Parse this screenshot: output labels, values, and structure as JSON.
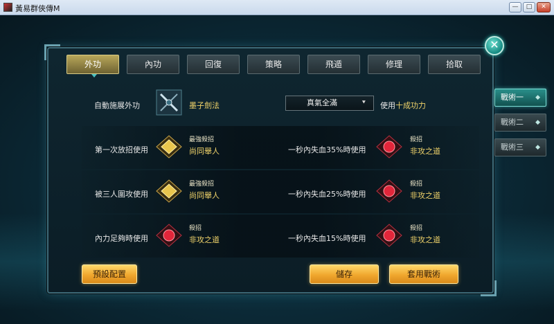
{
  "window": {
    "title": "黃易群俠傳M",
    "minimize": "—",
    "maximize": "□",
    "close": "✕"
  },
  "dialog": {
    "close_symbol": "✕"
  },
  "tabs": [
    {
      "label": "外功",
      "active": true
    },
    {
      "label": "內功",
      "active": false
    },
    {
      "label": "回復",
      "active": false
    },
    {
      "label": "策略",
      "active": false
    },
    {
      "label": "飛遁",
      "active": false
    },
    {
      "label": "修理",
      "active": false
    },
    {
      "label": "拾取",
      "active": false
    }
  ],
  "auto": {
    "label": "自動施展外功",
    "skill": "墨子劍法",
    "dropdown_value": "真氣全滿",
    "use_prefix": "使用",
    "use_highlight": "十成功力"
  },
  "slots": {
    "left_1": {
      "condition": "第一次放招使用",
      "type": "最強殺招",
      "name": "尚同舉人",
      "gem": "gold"
    },
    "left_2": {
      "condition": "被三人圍攻使用",
      "type": "最強殺招",
      "name": "尚同舉人",
      "gem": "gold"
    },
    "left_3": {
      "condition": "內力足夠時使用",
      "type": "殺招",
      "name": "非攻之道",
      "gem": "red"
    },
    "right_1": {
      "condition": "一秒內失血35%時使用",
      "type": "殺招",
      "name": "非攻之道",
      "gem": "red"
    },
    "right_2": {
      "condition": "一秒內失血25%時使用",
      "type": "殺招",
      "name": "非攻之道",
      "gem": "red"
    },
    "right_3": {
      "condition": "一秒內失血15%時使用",
      "type": "殺招",
      "name": "非攻之道",
      "gem": "red"
    }
  },
  "side_tabs": [
    {
      "label": "戰術一",
      "active": true
    },
    {
      "label": "戰術二",
      "active": false
    },
    {
      "label": "戰術三",
      "active": false
    }
  ],
  "side_marker": "◆",
  "buttons": {
    "preset": "預設配置",
    "save": "儲存",
    "apply": "套用戰術"
  },
  "colors": {
    "gold_text": "#f0d36a",
    "accent_teal": "#2a8f8a",
    "button_orange": "#f0a72e"
  }
}
